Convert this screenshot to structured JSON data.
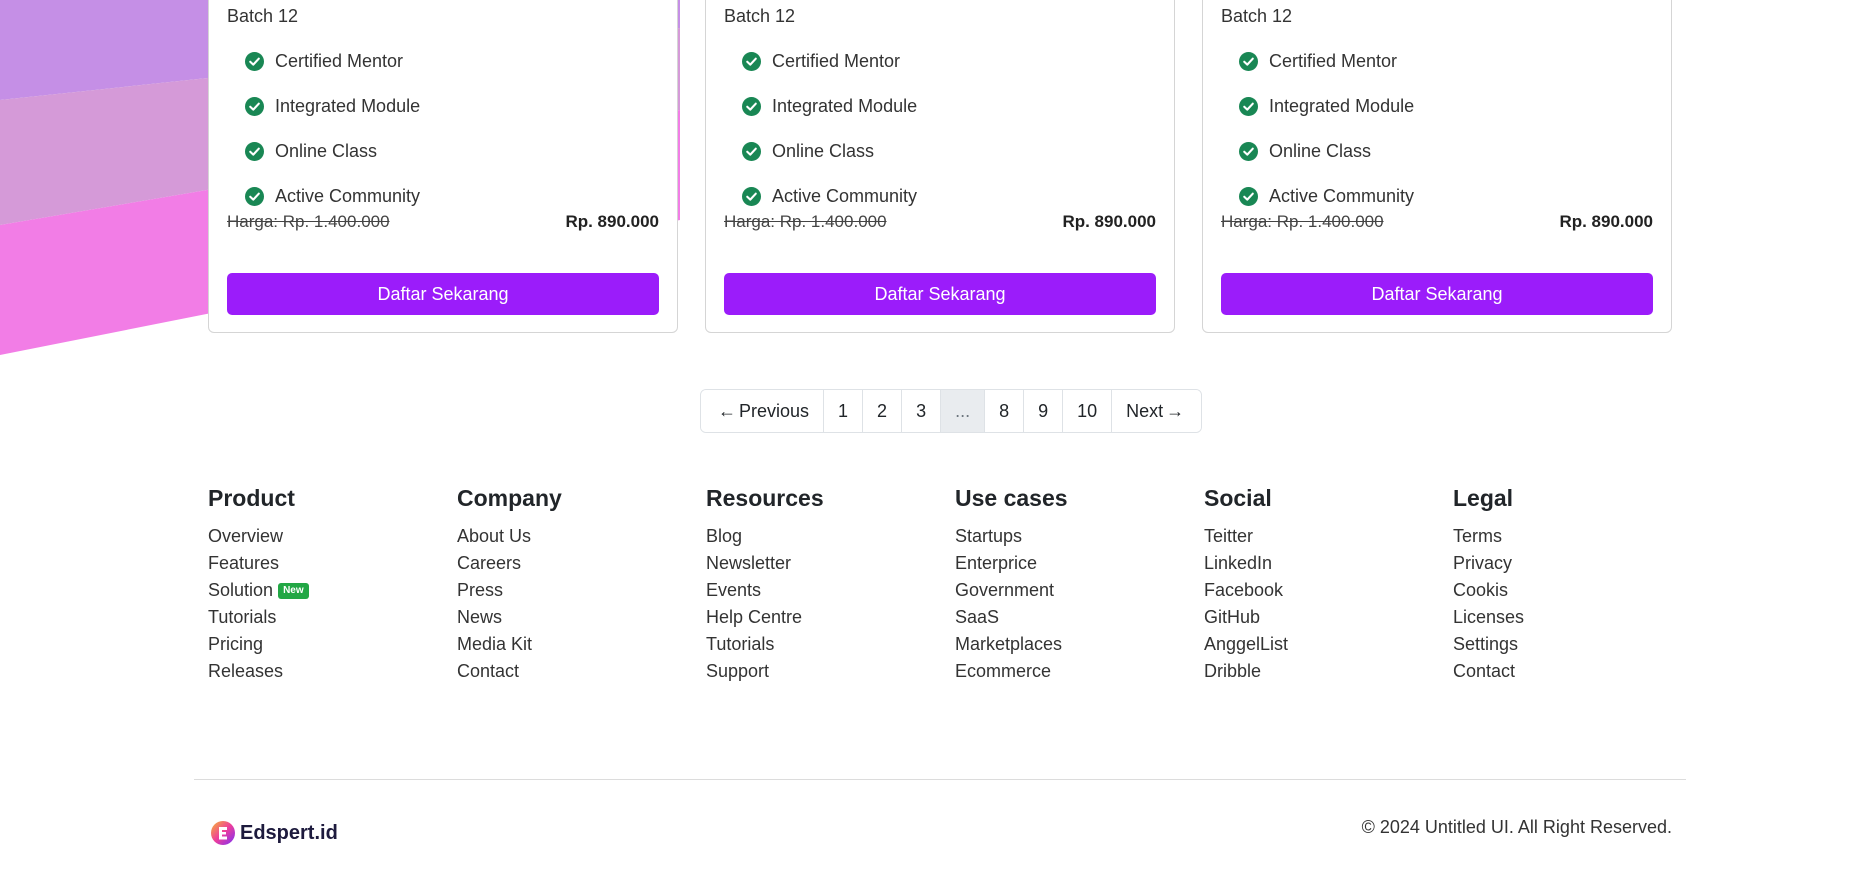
{
  "colors": {
    "accent": "#9b1cfa",
    "check": "#198754",
    "badge": "#22a745",
    "deco_purple": "#c57ee6",
    "deco_pink": "#ee6fe0"
  },
  "cards": [
    {
      "batch": "Batch 12",
      "features": [
        "Certified Mentor",
        "Integrated Module",
        "Online Class",
        "Active Community"
      ],
      "price_old": "Harga: Rp. 1.400.000",
      "price_new": "Rp. 890.000",
      "cta": "Daftar Sekarang"
    },
    {
      "batch": "Batch 12",
      "features": [
        "Certified Mentor",
        "Integrated Module",
        "Online Class",
        "Active Community"
      ],
      "price_old": "Harga: Rp. 1.400.000",
      "price_new": "Rp. 890.000",
      "cta": "Daftar Sekarang"
    },
    {
      "batch": "Batch 12",
      "features": [
        "Certified Mentor",
        "Integrated Module",
        "Online Class",
        "Active Community"
      ],
      "price_old": "Harga: Rp. 1.400.000",
      "price_new": "Rp. 890.000",
      "cta": "Daftar Sekarang"
    }
  ],
  "pagination": {
    "prev_arrow": "←",
    "prev_label": "Previous",
    "pages": [
      "1",
      "2",
      "3",
      "...",
      "8",
      "9",
      "10"
    ],
    "next_label": "Next",
    "next_arrow": "→"
  },
  "footer": {
    "columns": [
      {
        "heading": "Product",
        "links": [
          "Overview",
          "Features",
          "Solution",
          "Tutorials",
          "Pricing",
          "Releases"
        ]
      },
      {
        "heading": "Company",
        "links": [
          "About Us",
          "Careers",
          "Press",
          "News",
          "Media Kit",
          "Contact"
        ]
      },
      {
        "heading": "Resources",
        "links": [
          "Blog",
          "Newsletter",
          "Events",
          "Help Centre",
          "Tutorials",
          "Support"
        ]
      },
      {
        "heading": "Use cases",
        "links": [
          "Startups",
          "Enterprice",
          "Government",
          "SaaS",
          "Marketplaces",
          "Ecommerce"
        ]
      },
      {
        "heading": "Social",
        "links": [
          "Teitter",
          "LinkedIn",
          "Facebook",
          "GitHub",
          "AnggelList",
          "Dribble"
        ]
      },
      {
        "heading": "Legal",
        "links": [
          "Terms",
          "Privacy",
          "Cookis",
          "Licenses",
          "Settings",
          "Contact"
        ]
      }
    ],
    "new_badge": "New",
    "brand": "Edspert.id",
    "copyright": "© 2024 Untitled UI. All Right Reserved."
  }
}
